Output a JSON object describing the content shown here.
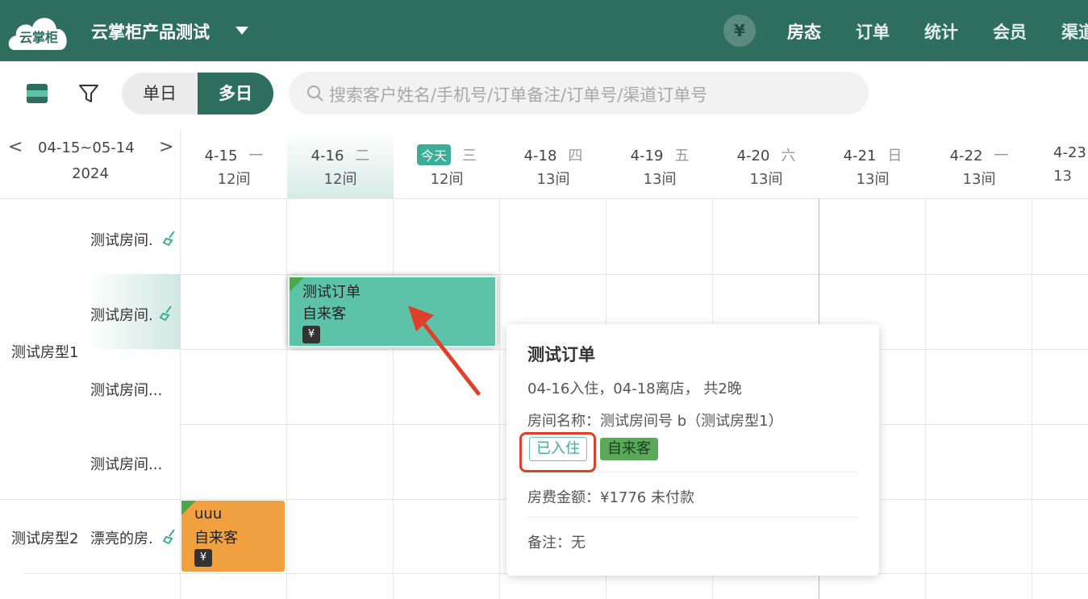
{
  "topbar": {
    "logo_text": "云掌柜",
    "shop_name": "云掌柜产品测试",
    "currency_icon": "¥",
    "nav": [
      "房态",
      "订单",
      "统计",
      "会员",
      "渠道"
    ]
  },
  "toolbar": {
    "mode_single": "单日",
    "mode_multi": "多日",
    "search_placeholder": "搜索客户姓名/手机号/订单备注/订单号/渠道订单号"
  },
  "range": {
    "prev": "<",
    "next": ">",
    "dates": "04-15~05-14",
    "year": "2024"
  },
  "days": [
    {
      "date": "4-15",
      "weekday": "一",
      "count": "12间"
    },
    {
      "date": "4-16",
      "weekday": "二",
      "count": "12间"
    },
    {
      "date": "今天",
      "weekday": "三",
      "count": "12间"
    },
    {
      "date": "4-18",
      "weekday": "四",
      "count": "13间"
    },
    {
      "date": "4-19",
      "weekday": "五",
      "count": "13间"
    },
    {
      "date": "4-20",
      "weekday": "六",
      "count": "13间"
    },
    {
      "date": "4-21",
      "weekday": "日",
      "count": "13间"
    },
    {
      "date": "4-22",
      "weekday": "一",
      "count": "13间"
    },
    {
      "date": "4-23",
      "weekday": "",
      "count": "13"
    }
  ],
  "room_types": [
    {
      "name": "测试房型1"
    },
    {
      "name": "测试房型2"
    }
  ],
  "rooms": [
    {
      "name": "测试房间."
    },
    {
      "name": "测试房间."
    },
    {
      "name": "测试房间..."
    },
    {
      "name": "测试房间..."
    },
    {
      "name": "漂亮的房."
    }
  ],
  "orders": [
    {
      "title": "测试订单",
      "channel": "自来客",
      "pay_icon": "¥",
      "color": "#5cc2a8"
    },
    {
      "title": "uuu",
      "channel": "自来客",
      "pay_icon": "¥",
      "color": "#f0a03e"
    }
  ],
  "popup": {
    "title": "测试订单",
    "stay": "04-16入住，04-18离店， 共2晚",
    "room": "房间名称：测试房间号 b（测试房型1）",
    "status_tag": "已入住",
    "channel_tag": "自来客",
    "fee": "房费金额：¥1776 未付款",
    "remark": "备注：无"
  }
}
